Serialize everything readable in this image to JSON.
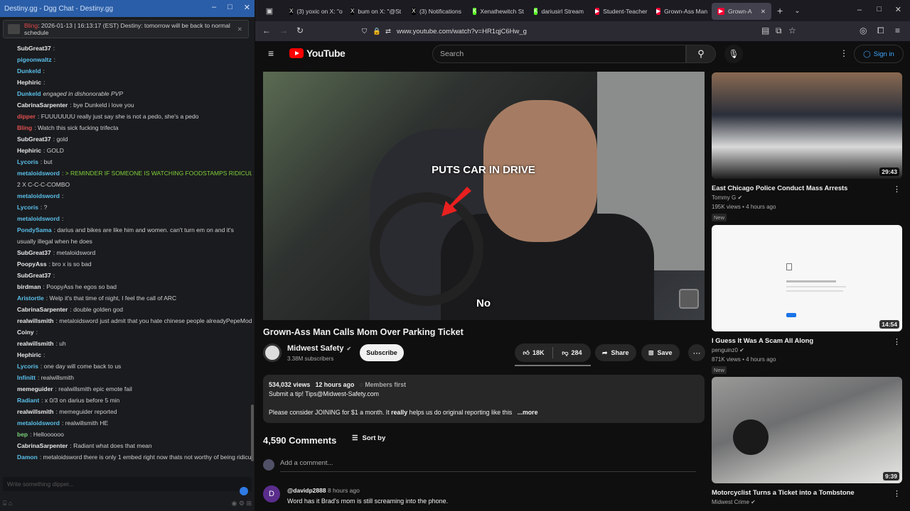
{
  "chat": {
    "title": "Destiny.gg - Dgg Chat - Destiny.gg",
    "notice": {
      "author": "Bling",
      "text": ": 2026-01-13 | 16:13:17 (EST) Destiny: tomorrow will be back to normal schedule"
    },
    "lines": [
      {
        "user": "SubGreat37",
        "text": ":",
        "color": "#e8e8e8"
      },
      {
        "user": "pigeonwaltz",
        "text": ":",
        "color": "#5bc0eb"
      },
      {
        "user": "Dunkeld",
        "text": ":",
        "color": "#5bc0eb"
      },
      {
        "user": "Hephiric",
        "text": ":",
        "color": "#e8e8e8"
      },
      {
        "user": "Dunkeld",
        "text": " engaged in dishonorable PVP",
        "color": "#5bc0eb",
        "italic": true
      },
      {
        "user": "CabrinaSarpenter",
        "text": ": bye Dunkeld i love you",
        "color": "#e8e8e8"
      },
      {
        "user": "dipper",
        "text": ": FUUUUUUU really just say she is not a pedo, she's a pedo",
        "color": "#e05050"
      },
      {
        "user": "Bling",
        "text": ": Watch this sick fucking trifecta",
        "color": "#e05050"
      },
      {
        "user": "SubGreat37",
        "text": ": gold",
        "color": "#e8e8e8"
      },
      {
        "user": "Hephiric",
        "text": ": GOLD",
        "color": "#e8e8e8"
      },
      {
        "user": "Lycoris",
        "text": ": but",
        "color": "#5bc0eb"
      },
      {
        "user": "metaloidsword",
        "text": ": > REMINDER IF SOMEONE IS WATCHING FOODSTAMPS RIDICULE THEM",
        "color": "#5bc0eb",
        "green": true
      },
      {
        "user": "",
        "text": "2 X C-C-C-COMBO",
        "color": "#e8e8e8"
      },
      {
        "user": "metaloidsword",
        "text": ":",
        "color": "#5bc0eb"
      },
      {
        "user": "Lycoris",
        "text": ": ?",
        "color": "#5bc0eb"
      },
      {
        "user": "metaloidsword",
        "text": ":",
        "color": "#5bc0eb"
      },
      {
        "user": "PondySama",
        "text": ": darius and bikes are like him and women. can't turn em on and it's",
        "color": "#5bc0eb"
      },
      {
        "user": "",
        "text": "usually illegal when he does",
        "color": "#e8e8e8"
      },
      {
        "user": "SubGreat37",
        "text": ": metaloidsword",
        "color": "#e8e8e8"
      },
      {
        "user": "PoopyAss",
        "text": ": bro x is so bad",
        "color": "#e8e8e8"
      },
      {
        "user": "SubGreat37",
        "text": ":",
        "color": "#e8e8e8"
      },
      {
        "user": "birdman",
        "text": ": PoopyAss he egos so bad",
        "color": "#e8e8e8"
      },
      {
        "user": "Aristortle",
        "text": ": Welp it's that time of night, I feel the call of ARC",
        "color": "#5bc0eb"
      },
      {
        "user": "CabrinaSarpenter",
        "text": ": double golden god",
        "color": "#e8e8e8"
      },
      {
        "user": "realwillsmith",
        "text": ": metaloidsword just admit that you hate chinese people alreadyPepeMods",
        "color": "#e8e8e8"
      },
      {
        "user": "Coiny",
        "text": ":",
        "color": "#e8e8e8"
      },
      {
        "user": "realwillsmith",
        "text": ": uh",
        "color": "#e8e8e8"
      },
      {
        "user": "Hephiric",
        "text": ":",
        "color": "#e8e8e8"
      },
      {
        "user": "Lycoris",
        "text": ": one day will come back to us",
        "color": "#5bc0eb"
      },
      {
        "user": "Infinitt",
        "text": ": realwillsmith",
        "color": "#5bc0eb"
      },
      {
        "user": "memeguider",
        "text": ": realwillsmith epic emote fail",
        "color": "#e8e8e8"
      },
      {
        "user": "Radiant",
        "text": ": x 0/3 on darius before 5 min",
        "color": "#5bc0eb"
      },
      {
        "user": "realwillsmith",
        "text": ": memeguider reported",
        "color": "#e8e8e8"
      },
      {
        "user": "metaloidsword",
        "text": ": realwillsmith HE",
        "color": "#5bc0eb"
      },
      {
        "user": "bep",
        "text": ": Helloooooo",
        "color": "#7ad17a"
      },
      {
        "user": "CabrinaSarpenter",
        "text": ": Radiant what does that mean",
        "color": "#e8e8e8"
      },
      {
        "user": "Damon",
        "text": ": metaloidsword there is only 1 embed right now thats not worthy of being ridiculed",
        "color": "#5bc0eb"
      }
    ],
    "input_placeholder": "Write something dipper..."
  },
  "browser": {
    "tabs": [
      {
        "label": "(3) yoxic on X: \"o",
        "fav": "X",
        "color": "#000000"
      },
      {
        "label": "bum on X: \"@St",
        "fav": "X",
        "color": "#000000"
      },
      {
        "label": "(3) Notifications",
        "fav": "X",
        "color": "#000000"
      },
      {
        "label": "Xenathewitch St",
        "fav": "K",
        "color": "#53fc18"
      },
      {
        "label": "dariusirl Stream",
        "fav": "K",
        "color": "#53fc18"
      },
      {
        "label": "Student-Teacher",
        "fav": "▶",
        "color": "#ff0033"
      },
      {
        "label": "Grown-Ass Man",
        "fav": "▶",
        "color": "#ff0033"
      },
      {
        "label": "Grown-A",
        "fav": "▶",
        "color": "#ff0033",
        "active": true
      }
    ],
    "url": "www.youtube.com/watch?v=HR1qjC6Hw_g"
  },
  "youtube": {
    "logo": "YouTube",
    "search_placeholder": "Search",
    "signin": "Sign in",
    "video": {
      "overlay_text": "PUTS CAR IN DRIVE",
      "subtitle": "No",
      "title": "Grown-Ass Man Calls Mom Over Parking Ticket",
      "channel": "Midwest Safety",
      "subs": "3.38M subscribers",
      "subscribe": "Subscribe",
      "likes": "18K",
      "dislikes": "284",
      "share": "Share",
      "save": "Save",
      "views": "534,032 views",
      "ago": "12 hours ago",
      "members": "Members first",
      "desc_line1": "Submit a tip! Tips@Midwest-Safety.com",
      "desc_line2_a": "Please consider JOINING for $1 a month. It ",
      "desc_line2_b": "really",
      "desc_line2_c": " helps us do original reporting like this",
      "more": "...more"
    },
    "comments": {
      "count": "4,590 Comments",
      "sort": "Sort by",
      "add": "Add a comment...",
      "first": {
        "avatar": "D",
        "author": "@davidp2888",
        "ago": "8 hours ago",
        "text": "Word has it Brad's mom is still screaming into the phone."
      }
    },
    "recommended": [
      {
        "title": "East Chicago Police Conduct Mass Arrests",
        "channel": "Tommy G",
        "stats": "195K views • 4 hours ago",
        "badge": "New",
        "duration": "29:43"
      },
      {
        "title": "I Guess It Was A Scam All Along",
        "channel": "penguinz0",
        "stats": "871K views • 4 hours ago",
        "badge": "New",
        "duration": "14:54"
      },
      {
        "title": "Motorcyclist Turns a Ticket into a Tombstone",
        "channel": "Midwest Crime",
        "stats": "",
        "badge": "",
        "duration": "9:39"
      }
    ]
  }
}
